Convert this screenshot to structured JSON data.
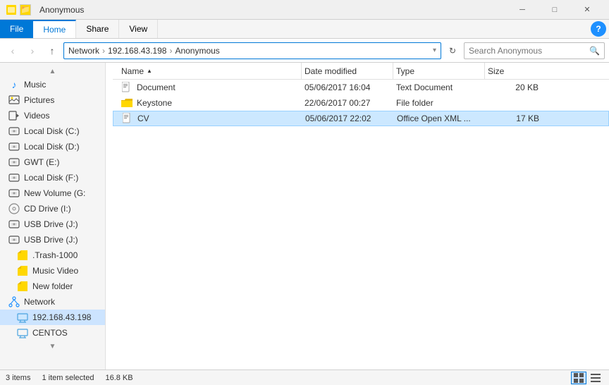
{
  "titleBar": {
    "title": "Anonymous",
    "icons": [
      "app-icon",
      "yellow-icon"
    ],
    "controls": [
      "minimize",
      "maximize",
      "close"
    ]
  },
  "ribbon": {
    "tabs": [
      {
        "label": "File",
        "id": "file",
        "active": false
      },
      {
        "label": "Home",
        "id": "home",
        "active": true
      },
      {
        "label": "Share",
        "id": "share",
        "active": false
      },
      {
        "label": "View",
        "id": "view",
        "active": false
      }
    ],
    "help": "?"
  },
  "addressBar": {
    "back": "‹",
    "forward": "›",
    "up": "↑",
    "path": [
      "Network",
      "192.168.43.198",
      "Anonymous"
    ],
    "pathSeparators": [
      "›",
      "›"
    ],
    "refresh": "↻",
    "searchPlaceholder": "Search Anonymous",
    "searchIcon": "🔍"
  },
  "sidebar": {
    "scrollUpLabel": "▲",
    "scrollDownLabel": "▼",
    "items": [
      {
        "label": "Music",
        "icon": "♪",
        "id": "music",
        "selected": false,
        "indent": false,
        "iconColor": "#1e90ff"
      },
      {
        "label": "Pictures",
        "icon": "▤",
        "id": "pictures",
        "selected": false,
        "indent": false,
        "iconColor": "#555"
      },
      {
        "label": "Videos",
        "icon": "▶",
        "id": "videos",
        "selected": false,
        "indent": false,
        "iconColor": "#555"
      },
      {
        "label": "Local Disk (C:)",
        "icon": "💿",
        "id": "disk-c",
        "selected": false,
        "indent": false,
        "iconColor": "#555"
      },
      {
        "label": "Local Disk (D:)",
        "icon": "💿",
        "id": "disk-d",
        "selected": false,
        "indent": false,
        "iconColor": "#555"
      },
      {
        "label": "GWT (E:)",
        "icon": "💿",
        "id": "gwt-e",
        "selected": false,
        "indent": false,
        "iconColor": "#555"
      },
      {
        "label": "Local Disk (F:)",
        "icon": "💿",
        "id": "disk-f",
        "selected": false,
        "indent": false,
        "iconColor": "#555"
      },
      {
        "label": "New Volume (G:",
        "icon": "💿",
        "id": "vol-g",
        "selected": false,
        "indent": false,
        "iconColor": "#555"
      },
      {
        "label": "CD Drive (I:)",
        "icon": "⊙",
        "id": "cd-i",
        "selected": false,
        "indent": false,
        "iconColor": "#888"
      },
      {
        "label": "USB Drive (J:)",
        "icon": "💿",
        "id": "usb-j1",
        "selected": false,
        "indent": false,
        "iconColor": "#555"
      },
      {
        "label": "USB Drive (J:)",
        "icon": "💿",
        "id": "usb-j2",
        "selected": false,
        "indent": false,
        "iconColor": "#555"
      },
      {
        "label": ".Trash-1000",
        "icon": "📁",
        "id": "trash",
        "selected": false,
        "indent": true,
        "iconColor": "#ffd700"
      },
      {
        "label": "Music Video",
        "icon": "📁",
        "id": "music-video",
        "selected": false,
        "indent": true,
        "iconColor": "#ffd700"
      },
      {
        "label": "New folder",
        "icon": "📁",
        "id": "new-folder",
        "selected": false,
        "indent": true,
        "iconColor": "#ffd700"
      },
      {
        "label": "Network",
        "icon": "🌐",
        "id": "network",
        "selected": false,
        "indent": false,
        "iconColor": "#1e90ff"
      },
      {
        "label": "192.168.43.198",
        "icon": "🖥",
        "id": "ip-addr",
        "selected": true,
        "indent": true,
        "iconColor": "#4aa4e0"
      },
      {
        "label": "CENTOS",
        "icon": "🖥",
        "id": "centos",
        "selected": false,
        "indent": true,
        "iconColor": "#4aa4e0"
      }
    ]
  },
  "fileList": {
    "columns": [
      {
        "label": "Name",
        "id": "name",
        "sortIndicator": "▲"
      },
      {
        "label": "Date modified",
        "id": "date"
      },
      {
        "label": "Type",
        "id": "type"
      },
      {
        "label": "Size",
        "id": "size"
      }
    ],
    "files": [
      {
        "name": "Document",
        "icon": "doc",
        "date": "05/06/2017 16:04",
        "type": "Text Document",
        "size": "20 KB",
        "selected": false
      },
      {
        "name": "Keystone",
        "icon": "folder",
        "date": "22/06/2017 00:27",
        "type": "File folder",
        "size": "",
        "selected": false
      },
      {
        "name": "CV",
        "icon": "doc",
        "date": "05/06/2017 22:02",
        "type": "Office Open XML ...",
        "size": "17 KB",
        "selected": true
      }
    ]
  },
  "statusBar": {
    "itemCount": "3 items",
    "selectedInfo": "1 item selected",
    "selectedSize": "16.8 KB",
    "viewIcons": [
      "⊞",
      "☰"
    ]
  }
}
